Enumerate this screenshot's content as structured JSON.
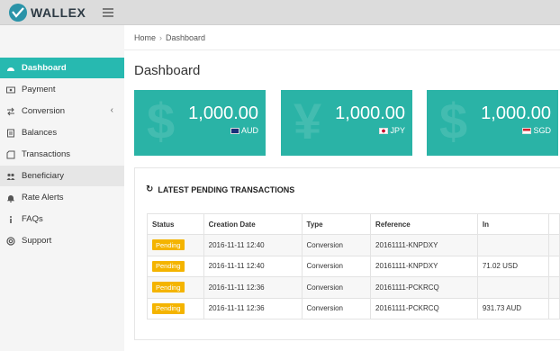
{
  "app": {
    "brand": "WALLEX"
  },
  "sidebar": {
    "items": [
      {
        "label": "Dashboard",
        "icon": "dashboard-icon"
      },
      {
        "label": "Payment",
        "icon": "payment-icon"
      },
      {
        "label": "Conversion",
        "icon": "conversion-icon"
      },
      {
        "label": "Balances",
        "icon": "balances-icon"
      },
      {
        "label": "Transactions",
        "icon": "transactions-icon"
      },
      {
        "label": "Beneficiary",
        "icon": "beneficiary-icon"
      },
      {
        "label": "Rate Alerts",
        "icon": "bell-icon"
      },
      {
        "label": "FAQs",
        "icon": "info-icon"
      },
      {
        "label": "Support",
        "icon": "support-icon"
      }
    ]
  },
  "breadcrumb": {
    "home": "Home",
    "current": "Dashboard"
  },
  "page": {
    "title": "Dashboard"
  },
  "cards": [
    {
      "amount": "1,000.00",
      "currency": "AUD",
      "symbol": "$"
    },
    {
      "amount": "1,000.00",
      "currency": "JPY",
      "symbol": "¥"
    },
    {
      "amount": "1,000.00",
      "currency": "SGD",
      "symbol": "$"
    }
  ],
  "pending": {
    "title": "LATEST PENDING TRANSACTIONS",
    "headers": [
      "Status",
      "Creation Date",
      "Type",
      "Reference",
      "In"
    ],
    "rows": [
      {
        "status": "Pending",
        "date": "2016-11-11 12:40",
        "type": "Conversion",
        "reference": "20161111-KNPDXY",
        "in": ""
      },
      {
        "status": "Pending",
        "date": "2016-11-11 12:40",
        "type": "Conversion",
        "reference": "20161111-KNPDXY",
        "in": "71.02 USD"
      },
      {
        "status": "Pending",
        "date": "2016-11-11 12:36",
        "type": "Conversion",
        "reference": "20161111-PCKRCQ",
        "in": ""
      },
      {
        "status": "Pending",
        "date": "2016-11-11 12:36",
        "type": "Conversion",
        "reference": "20161111-PCKRCQ",
        "in": "931.73 AUD"
      }
    ]
  },
  "colors": {
    "accent": "#27b9b0",
    "card": "#2ab3a6",
    "pending_badge": "#f4b400"
  }
}
